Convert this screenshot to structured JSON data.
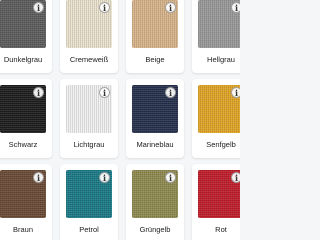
{
  "swatches": [
    {
      "label": "Dunkelgrau",
      "color": "#5c5d5c",
      "info_icon": "info-icon"
    },
    {
      "label": "Cremeweiß",
      "color": "#ece3cf",
      "info_icon": "info-icon"
    },
    {
      "label": "Beige",
      "color": "#d8b48a",
      "info_icon": "info-icon"
    },
    {
      "label": "Hellgrau",
      "color": "#9a9a9a",
      "info_icon": "info-icon"
    },
    {
      "label": "Schwarz",
      "color": "#1d1d1d",
      "info_icon": "info-icon"
    },
    {
      "label": "Lichtgrau",
      "color": "#f1f1f1",
      "info_icon": "info-icon"
    },
    {
      "label": "Marineblau",
      "color": "#26304c",
      "info_icon": "info-icon"
    },
    {
      "label": "Senfgelb",
      "color": "#e0a524",
      "info_icon": "info-icon"
    },
    {
      "label": "Braun",
      "color": "#6a4b35",
      "info_icon": "info-icon"
    },
    {
      "label": "Petrol",
      "color": "#1a7a87",
      "info_icon": "info-icon"
    },
    {
      "label": "Grüngelb",
      "color": "#8f8a4f",
      "info_icon": "info-icon"
    },
    {
      "label": "Rot",
      "color": "#c01d2b",
      "info_icon": "info-icon"
    }
  ]
}
